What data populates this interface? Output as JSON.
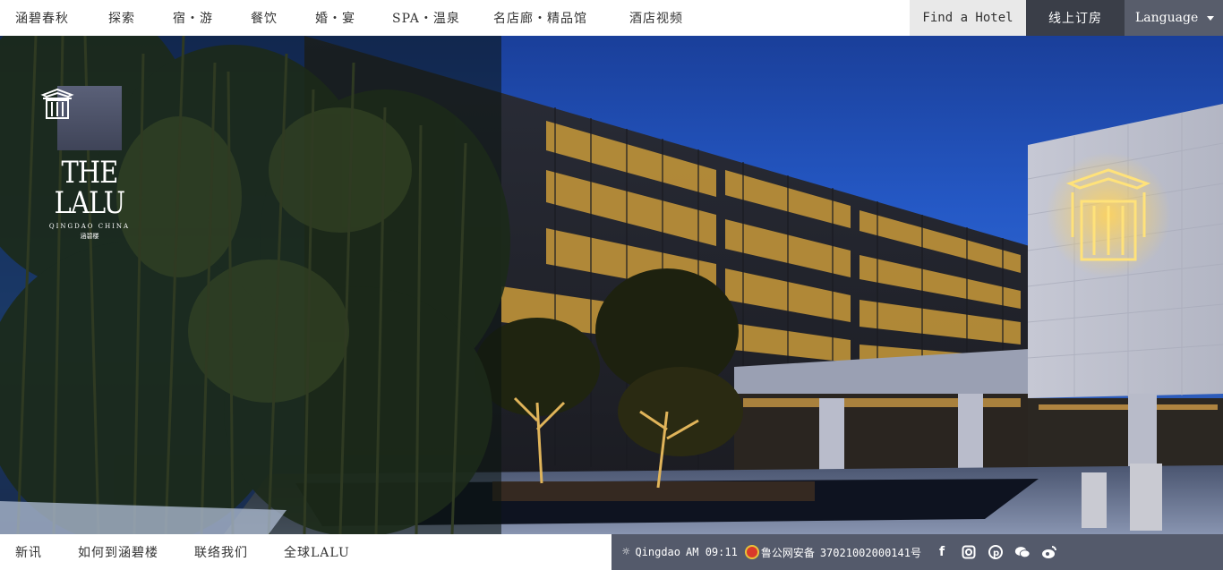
{
  "nav": {
    "items": [
      "涵碧春秋",
      "探索",
      "宿・游",
      "餐饮",
      "婚・宴",
      "SPA・温泉",
      "名店廊・精品馆",
      "酒店视频"
    ],
    "find_hotel": "Find a Hotel",
    "book_online": "线上订房",
    "language": "Language"
  },
  "logo": {
    "name": "THE LALU",
    "subtitle": "QINGDAO CHINA",
    "cn": "涵碧楼"
  },
  "footer": {
    "links": [
      "新讯",
      "如何到涵碧楼",
      "联络我们",
      "全球LALU"
    ],
    "city": "Qingdao",
    "time": "AM 09:11",
    "license_label": "鲁公网安备",
    "license_number": "37021002000141号",
    "socials": [
      "facebook-icon",
      "instagram-icon",
      "pinterest-icon",
      "wechat-icon",
      "weibo-icon"
    ]
  },
  "colors": {
    "book_bg": "#3a3e48",
    "lang_bg": "#585d6b",
    "footer_bg": "#545a6b",
    "find_bg": "#e9e9e9"
  }
}
